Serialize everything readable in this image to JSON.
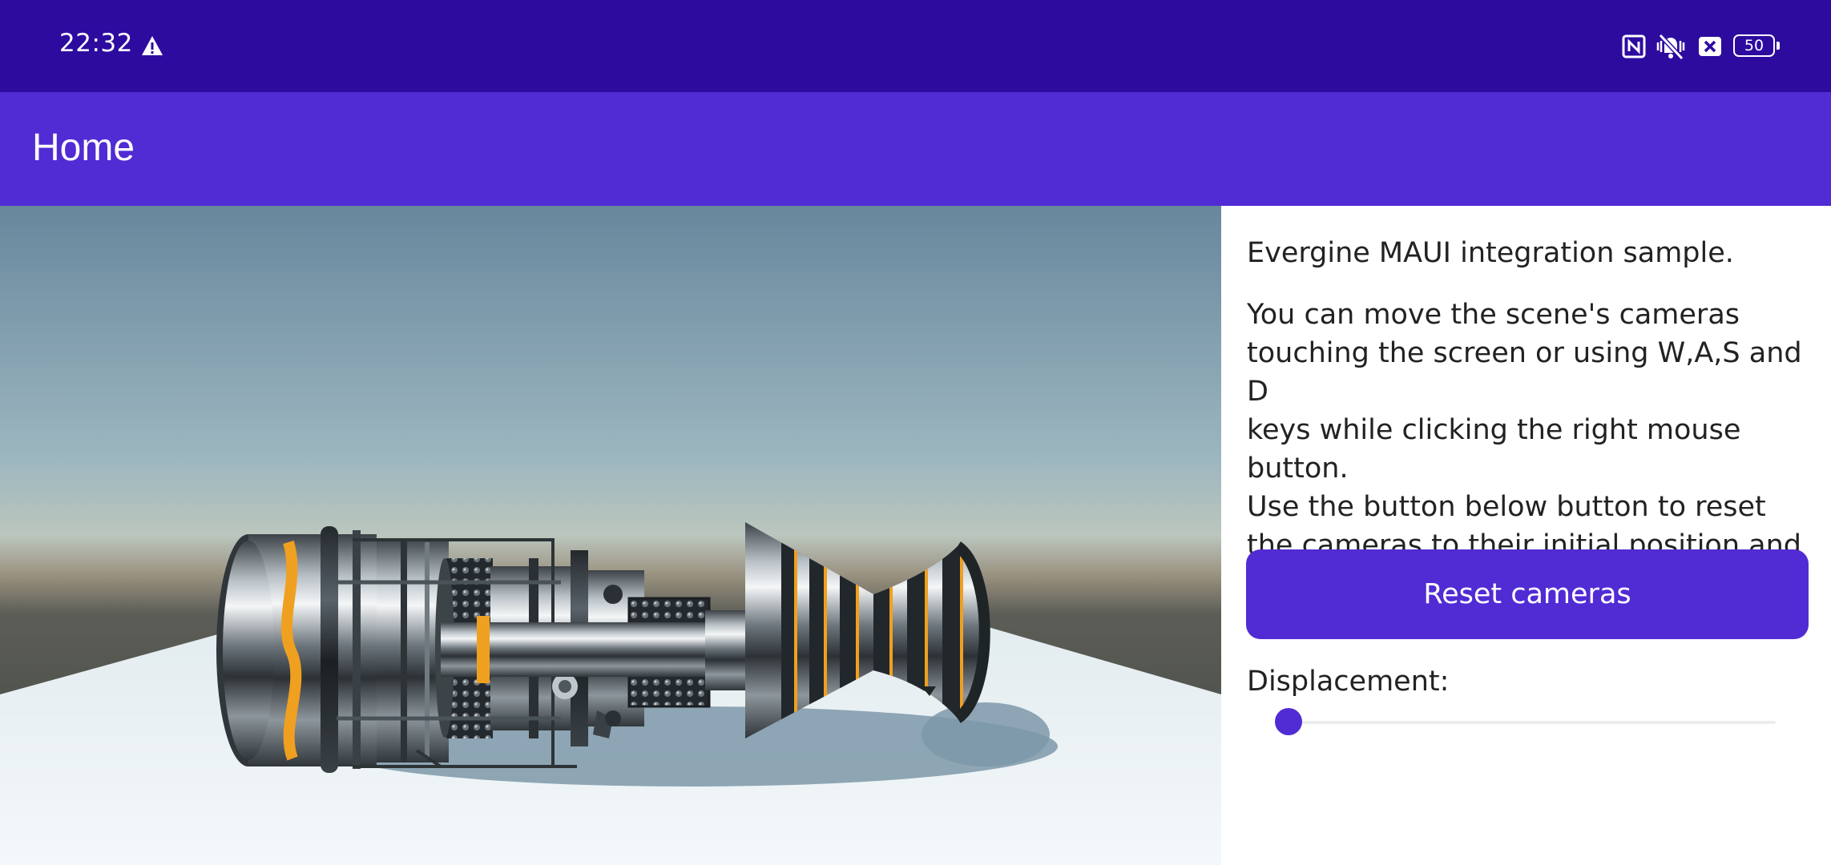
{
  "status_bar": {
    "time": "22:32",
    "battery": "50",
    "icons": [
      "warning-icon",
      "nfc-icon",
      "vibrate-off-icon",
      "xbox-icon",
      "battery-icon"
    ]
  },
  "app_bar": {
    "title": "Home"
  },
  "panel": {
    "intro": "Evergine MAUI integration sample.",
    "description": "You can move the scene's cameras\ntouching the screen or using W,A,S and D\nkeys while clicking the right mouse button.\nUse the button below button to reset\nthe cameras to their initial position and\norientation.",
    "reset_button": "Reset cameras",
    "displacement_label": "Displacement:",
    "displacement_value": 0.02
  },
  "colors": {
    "status_bar": "#2d0b9f",
    "accent": "#512bd4",
    "engine_stripe": "#f0a020"
  }
}
